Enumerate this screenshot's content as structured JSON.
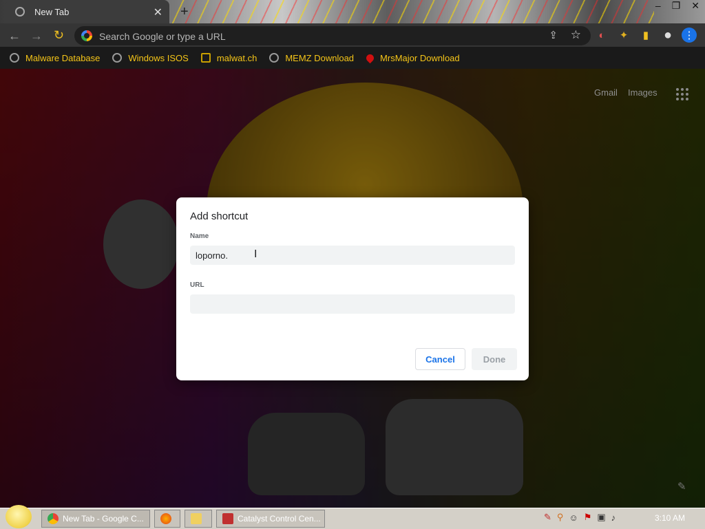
{
  "window": {
    "tab_title": "New Tab",
    "tab_close": "✕",
    "new_tab": "+",
    "controls": [
      "–",
      "❐",
      "✕"
    ]
  },
  "toolbar": {
    "back": "←",
    "forward": "→",
    "reload": "↻",
    "omnibox_placeholder": "Search Google or type a URL",
    "share": "⇪",
    "star": "☆"
  },
  "extensions": [
    {
      "name": "profile-flag-icon",
      "glyph": "◐",
      "color": "#e05050"
    },
    {
      "name": "puzzle-icon",
      "glyph": "✦",
      "color": "#e0b020"
    },
    {
      "name": "sidepanel-icon",
      "glyph": "▮",
      "color": "#f0c020"
    },
    {
      "name": "account-icon",
      "glyph": "●",
      "color": "#ddd"
    },
    {
      "name": "menu-icon",
      "glyph": "⋮",
      "color": "#fff"
    }
  ],
  "bookmarks": [
    {
      "label": "Malware Database"
    },
    {
      "label": "Windows ISOS"
    },
    {
      "label": "malwat.ch"
    },
    {
      "label": "MEMZ Download"
    },
    {
      "label": "MrsMajor Download"
    }
  ],
  "ntp": {
    "gmail": "Gmail",
    "images": "Images",
    "pencil": "✎"
  },
  "dialog": {
    "title": "Add shortcut",
    "name_label": "Name",
    "name_value": "loporno.",
    "url_label": "URL",
    "url_value": "",
    "cancel": "Cancel",
    "done": "Done",
    "text_cursor": "I"
  },
  "taskbar": {
    "items": [
      {
        "label": "New Tab - Google C..."
      },
      {
        "label": ""
      },
      {
        "label": ""
      },
      {
        "label": "Catalyst Control Cen..."
      }
    ],
    "clock": "3:10 AM"
  },
  "colors": {
    "accent": "#1a73e8",
    "bookmark_text": "#f5c518"
  }
}
